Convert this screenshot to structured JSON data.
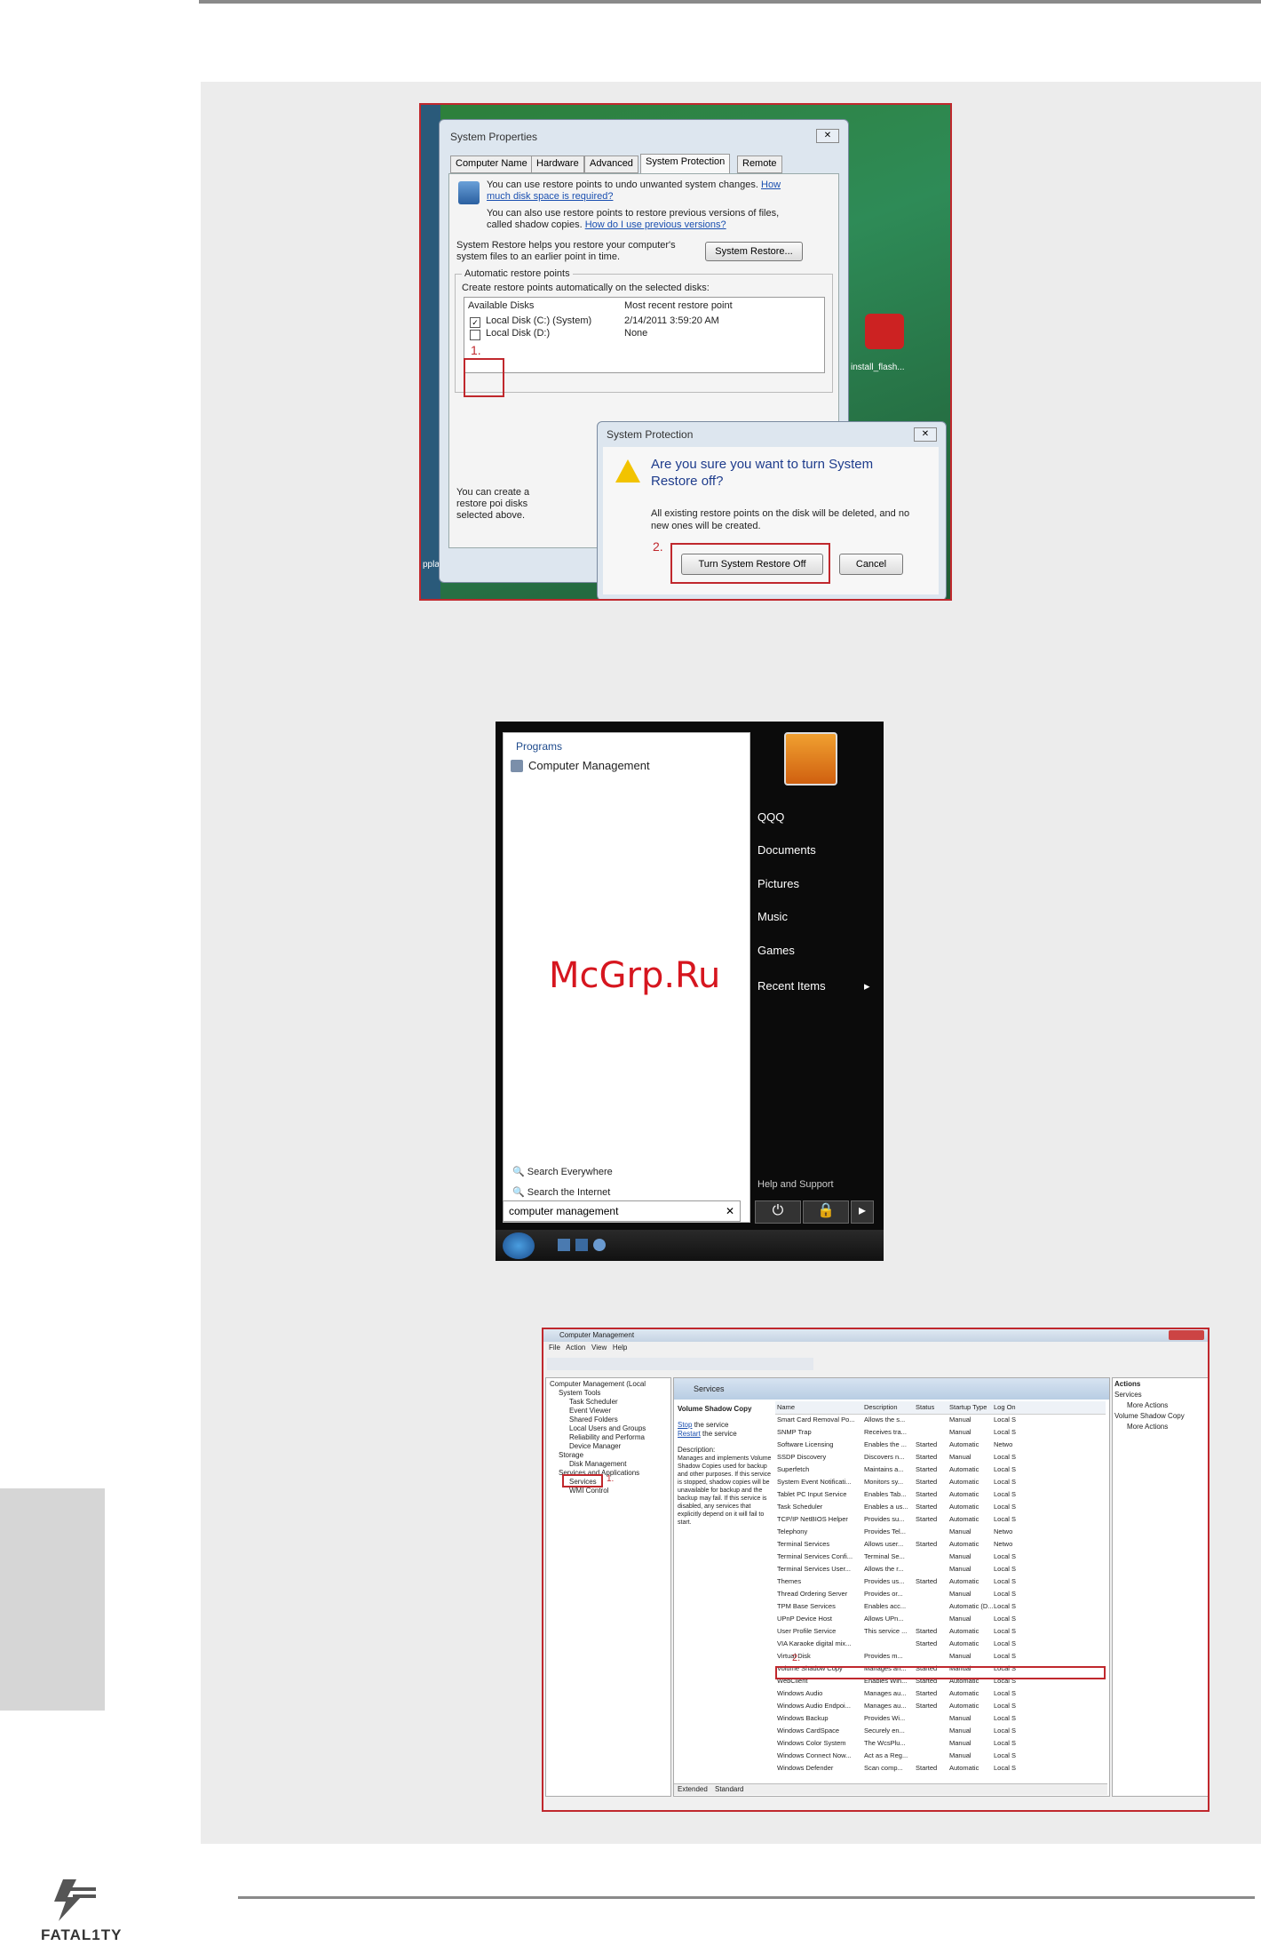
{
  "watermark": "McGrp.Ru",
  "brand": {
    "logo_text": "FATAL1TY"
  },
  "shot1": {
    "window_title": "System Properties",
    "tabs": [
      "Computer Name",
      "Hardware",
      "Advanced",
      "System Protection",
      "Remote"
    ],
    "intro1": "You can use restore points to undo unwanted system changes.",
    "intro1_link": "How much disk space is required?",
    "intro2": "You can also use restore points to restore previous versions of files, called shadow copies.",
    "intro2_link": "How do I use previous versions?",
    "restore_text": "System Restore helps you restore your computer's system files to an earlier point in time.",
    "restore_button": "System Restore...",
    "auto_group": "Automatic restore points",
    "auto_desc": "Create restore points automatically on the selected disks:",
    "col_disks": "Available Disks",
    "col_recent": "Most recent restore point",
    "disks": [
      {
        "name": "Local Disk (C:) (System)",
        "recent": "2/14/2011 3:59:20 AM"
      },
      {
        "name": "Local Disk (D:)",
        "recent": "None"
      }
    ],
    "bottom_text": "You can create a restore poi disks selected above.",
    "step1": "1.",
    "step2": "2.",
    "desktop_icon_label": "install_flash...",
    "desktop_edge": "pplay.exe",
    "dialog": {
      "title": "System Protection",
      "question": "Are you sure you want to turn System Restore off?",
      "detail": "All existing restore points on the disk will be deleted, and no new ones will be created.",
      "ok": "Turn System Restore Off",
      "cancel": "Cancel"
    }
  },
  "shot2": {
    "programs_header": "Programs",
    "program_item": "Computer Management",
    "right_items": [
      "QQQ",
      "Documents",
      "Pictures",
      "Music",
      "Games",
      "Recent Items"
    ],
    "search_everywhere": "Search Everywhere",
    "search_internet": "Search the Internet",
    "search_value": "computer management",
    "help_item": "Help and Support"
  },
  "shot3": {
    "title": "Computer Management",
    "menu": [
      "File",
      "Action",
      "View",
      "Help"
    ],
    "tree": [
      "Computer Management (Local",
      "System Tools",
      "Task Scheduler",
      "Event Viewer",
      "Shared Folders",
      "Local Users and Groups",
      "Reliability and Performa",
      "Device Manager",
      "Storage",
      "Disk Management",
      "Services and Applications",
      "Services",
      "WMI Control"
    ],
    "services_header": "Services",
    "selected_service": "Volume Shadow Copy",
    "stop_link": "Stop",
    "stop_text": "the service",
    "restart_link": "Restart",
    "restart_text": "the service",
    "desc_label": "Description:",
    "description": "Manages and implements Volume Shadow Copies used for backup and other purposes. If this service is stopped, shadow copies will be unavailable for backup and the backup may fail. If this service is disabled, any services that explicitly depend on it will fail to start.",
    "columns": [
      "Name",
      "Description",
      "Status",
      "Startup Type",
      "Log On"
    ],
    "rows": [
      [
        "Smart Card Removal Po...",
        "Allows the s...",
        "",
        "Manual",
        "Local S"
      ],
      [
        "SNMP Trap",
        "Receives tra...",
        "",
        "Manual",
        "Local S"
      ],
      [
        "Software Licensing",
        "Enables the ...",
        "Started",
        "Automatic",
        "Netwo"
      ],
      [
        "SSDP Discovery",
        "Discovers n...",
        "Started",
        "Manual",
        "Local S"
      ],
      [
        "Superfetch",
        "Maintains a...",
        "Started",
        "Automatic",
        "Local S"
      ],
      [
        "System Event Notificati...",
        "Monitors sy...",
        "Started",
        "Automatic",
        "Local S"
      ],
      [
        "Tablet PC Input Service",
        "Enables Tab...",
        "Started",
        "Automatic",
        "Local S"
      ],
      [
        "Task Scheduler",
        "Enables a us...",
        "Started",
        "Automatic",
        "Local S"
      ],
      [
        "TCP/IP NetBIOS Helper",
        "Provides su...",
        "Started",
        "Automatic",
        "Local S"
      ],
      [
        "Telephony",
        "Provides Tel...",
        "",
        "Manual",
        "Netwo"
      ],
      [
        "Terminal Services",
        "Allows user...",
        "Started",
        "Automatic",
        "Netwo"
      ],
      [
        "Terminal Services Confi...",
        "Terminal Se...",
        "",
        "Manual",
        "Local S"
      ],
      [
        "Terminal Services User...",
        "Allows the r...",
        "",
        "Manual",
        "Local S"
      ],
      [
        "Themes",
        "Provides us...",
        "Started",
        "Automatic",
        "Local S"
      ],
      [
        "Thread Ordering Server",
        "Provides or...",
        "",
        "Manual",
        "Local S"
      ],
      [
        "TPM Base Services",
        "Enables acc...",
        "",
        "Automatic (D...",
        "Local S"
      ],
      [
        "UPnP Device Host",
        "Allows UPn...",
        "",
        "Manual",
        "Local S"
      ],
      [
        "User Profile Service",
        "This service ...",
        "Started",
        "Automatic",
        "Local S"
      ],
      [
        "VIA Karaoke digital mix...",
        "",
        "Started",
        "Automatic",
        "Local S"
      ],
      [
        "Virtual Disk",
        "Provides m...",
        "",
        "Manual",
        "Local S"
      ],
      [
        "Volume Shadow Copy",
        "Manages an...",
        "Started",
        "Manual",
        "Local S"
      ],
      [
        "WebClient",
        "Enables Win...",
        "Started",
        "Automatic",
        "Local S"
      ],
      [
        "Windows Audio",
        "Manages au...",
        "Started",
        "Automatic",
        "Local S"
      ],
      [
        "Windows Audio Endpoi...",
        "Manages au...",
        "Started",
        "Automatic",
        "Local S"
      ],
      [
        "Windows Backup",
        "Provides Wi...",
        "",
        "Manual",
        "Local S"
      ],
      [
        "Windows CardSpace",
        "Securely en...",
        "",
        "Manual",
        "Local S"
      ],
      [
        "Windows Color System",
        "The WcsPlu...",
        "",
        "Manual",
        "Local S"
      ],
      [
        "Windows Connect Now...",
        "Act as a Reg...",
        "",
        "Manual",
        "Local S"
      ],
      [
        "Windows Defender",
        "Scan comp...",
        "Started",
        "Automatic",
        "Local S"
      ]
    ],
    "actions_header": "Actions",
    "actions": [
      {
        "label": "Services",
        "indent": false
      },
      {
        "label": "More Actions",
        "indent": true
      },
      {
        "label": "Volume Shadow Copy",
        "indent": false
      },
      {
        "label": "More Actions",
        "indent": true
      }
    ],
    "tab_extended": "Extended",
    "tab_standard": "Standard",
    "step1": "1.",
    "step2": "2."
  }
}
